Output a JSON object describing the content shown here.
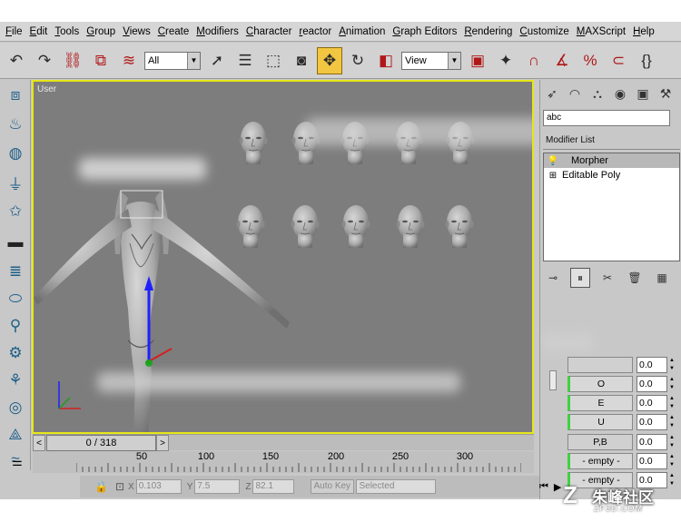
{
  "menu": [
    "File",
    "Edit",
    "Tools",
    "Group",
    "Views",
    "Create",
    "Modifiers",
    "Character",
    "reactor",
    "Animation",
    "Graph Editors",
    "Rendering",
    "Customize",
    "MAXScript",
    "Help"
  ],
  "toolbar": {
    "selection_filter": "All",
    "ref_coord": "View",
    "icons": [
      "undo-icon",
      "redo-icon",
      "select-link-icon",
      "unlink-icon",
      "bind-space-warp-icon",
      "select-object-icon",
      "select-by-name-icon",
      "rect-selection-icon",
      "window-crossing-icon",
      "move-icon",
      "rotate-icon",
      "scale-icon",
      "mirror-icon",
      "align-icon",
      "snap-3d-icon",
      "angle-snap-icon",
      "percent-snap-icon",
      "spinner-snap-icon",
      "named-selection-icon"
    ],
    "active_tool": "move-icon"
  },
  "viewport": {
    "label": "User",
    "border_color": "#e6e61a",
    "background": "#7d7d7d"
  },
  "command_panel": {
    "name_field": "abc",
    "modifier_list": "Modifier List",
    "stack": [
      {
        "label": "Morpher",
        "selected": true,
        "prefix": "bulb"
      },
      {
        "label": "Editable Poly",
        "selected": false,
        "prefix": "plus"
      }
    ],
    "channels": [
      {
        "label": "",
        "value": "0.0",
        "active": false
      },
      {
        "label": "O",
        "value": "0.0",
        "active": true
      },
      {
        "label": "E",
        "value": "0.0",
        "active": true
      },
      {
        "label": "U",
        "value": "0.0",
        "active": true
      },
      {
        "label": "P,B",
        "value": "0.0",
        "active": false
      },
      {
        "label": "- empty -",
        "value": "0.0",
        "active": true
      },
      {
        "label": "- empty -",
        "value": "0.0",
        "active": true
      }
    ]
  },
  "timeline": {
    "current": "0 / 318",
    "tick_labels": [
      "50",
      "100",
      "150",
      "200",
      "250",
      "300"
    ]
  },
  "status": {
    "x_label": "X",
    "x_value": "0.103",
    "y_label": "Y",
    "y_value": "7.5",
    "z_label": "Z",
    "z_value": "82.1",
    "auto_key": "Auto Key",
    "selected": "Selected"
  },
  "watermark": {
    "name": "朱峰社区",
    "url": "ZF3D.COM",
    "logo": "Z"
  }
}
